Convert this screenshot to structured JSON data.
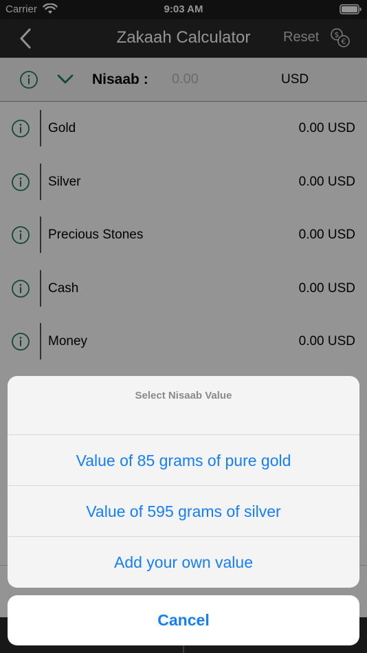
{
  "status_bar": {
    "carrier": "Carrier",
    "time": "9:03 AM"
  },
  "nav": {
    "title": "Zakaah Calculator",
    "reset_label": "Reset"
  },
  "nisaab": {
    "label": "Nisaab :",
    "placeholder": "0.00",
    "currency": "USD"
  },
  "assets": [
    {
      "name": "Gold",
      "value": "0.00 USD"
    },
    {
      "name": "Silver",
      "value": "0.00 USD"
    },
    {
      "name": "Precious Stones",
      "value": "0.00 USD"
    },
    {
      "name": "Cash",
      "value": "0.00 USD"
    },
    {
      "name": "Money",
      "value": "0.00 USD"
    }
  ],
  "action_sheet": {
    "title": "Select Nisaab Value",
    "options": [
      "Value of 85 grams of pure gold",
      "Value of 595 grams of silver",
      "Add your own value"
    ],
    "cancel_label": "Cancel"
  },
  "colors": {
    "accent": "#147efb",
    "info_icon": "#1d7a63",
    "nav_bg": "#2a2a2a"
  },
  "icons": {
    "back": "chevron-left-icon",
    "currency": "currency-exchange-icon",
    "info": "info-circle-icon",
    "expand": "chevron-down-icon",
    "wifi": "wifi-icon",
    "battery": "battery-icon"
  }
}
